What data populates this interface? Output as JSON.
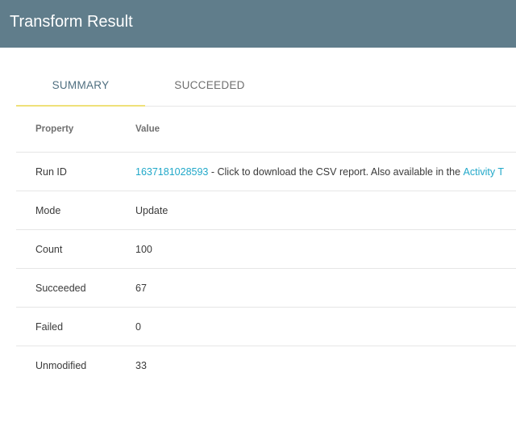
{
  "header": {
    "title": "Transform Result"
  },
  "tabs": [
    {
      "label": "SUMMARY",
      "active": true
    },
    {
      "label": "SUCCEEDED",
      "active": false
    }
  ],
  "table": {
    "columns": {
      "property": "Property",
      "value": "Value"
    },
    "run_id": {
      "label": "Run ID",
      "link": "1637181028593",
      "text": " - Click to download the CSV report. Also available in the ",
      "activity_link": "Activity T"
    },
    "rows": [
      {
        "property": "Mode",
        "value": "Update"
      },
      {
        "property": "Count",
        "value": "100"
      },
      {
        "property": "Succeeded",
        "value": "67"
      },
      {
        "property": "Failed",
        "value": "0"
      },
      {
        "property": "Unmodified",
        "value": "33"
      }
    ]
  },
  "colors": {
    "header_bg": "#607d8b",
    "tab_indicator": "#efe17a",
    "link": "#21a8c9"
  }
}
